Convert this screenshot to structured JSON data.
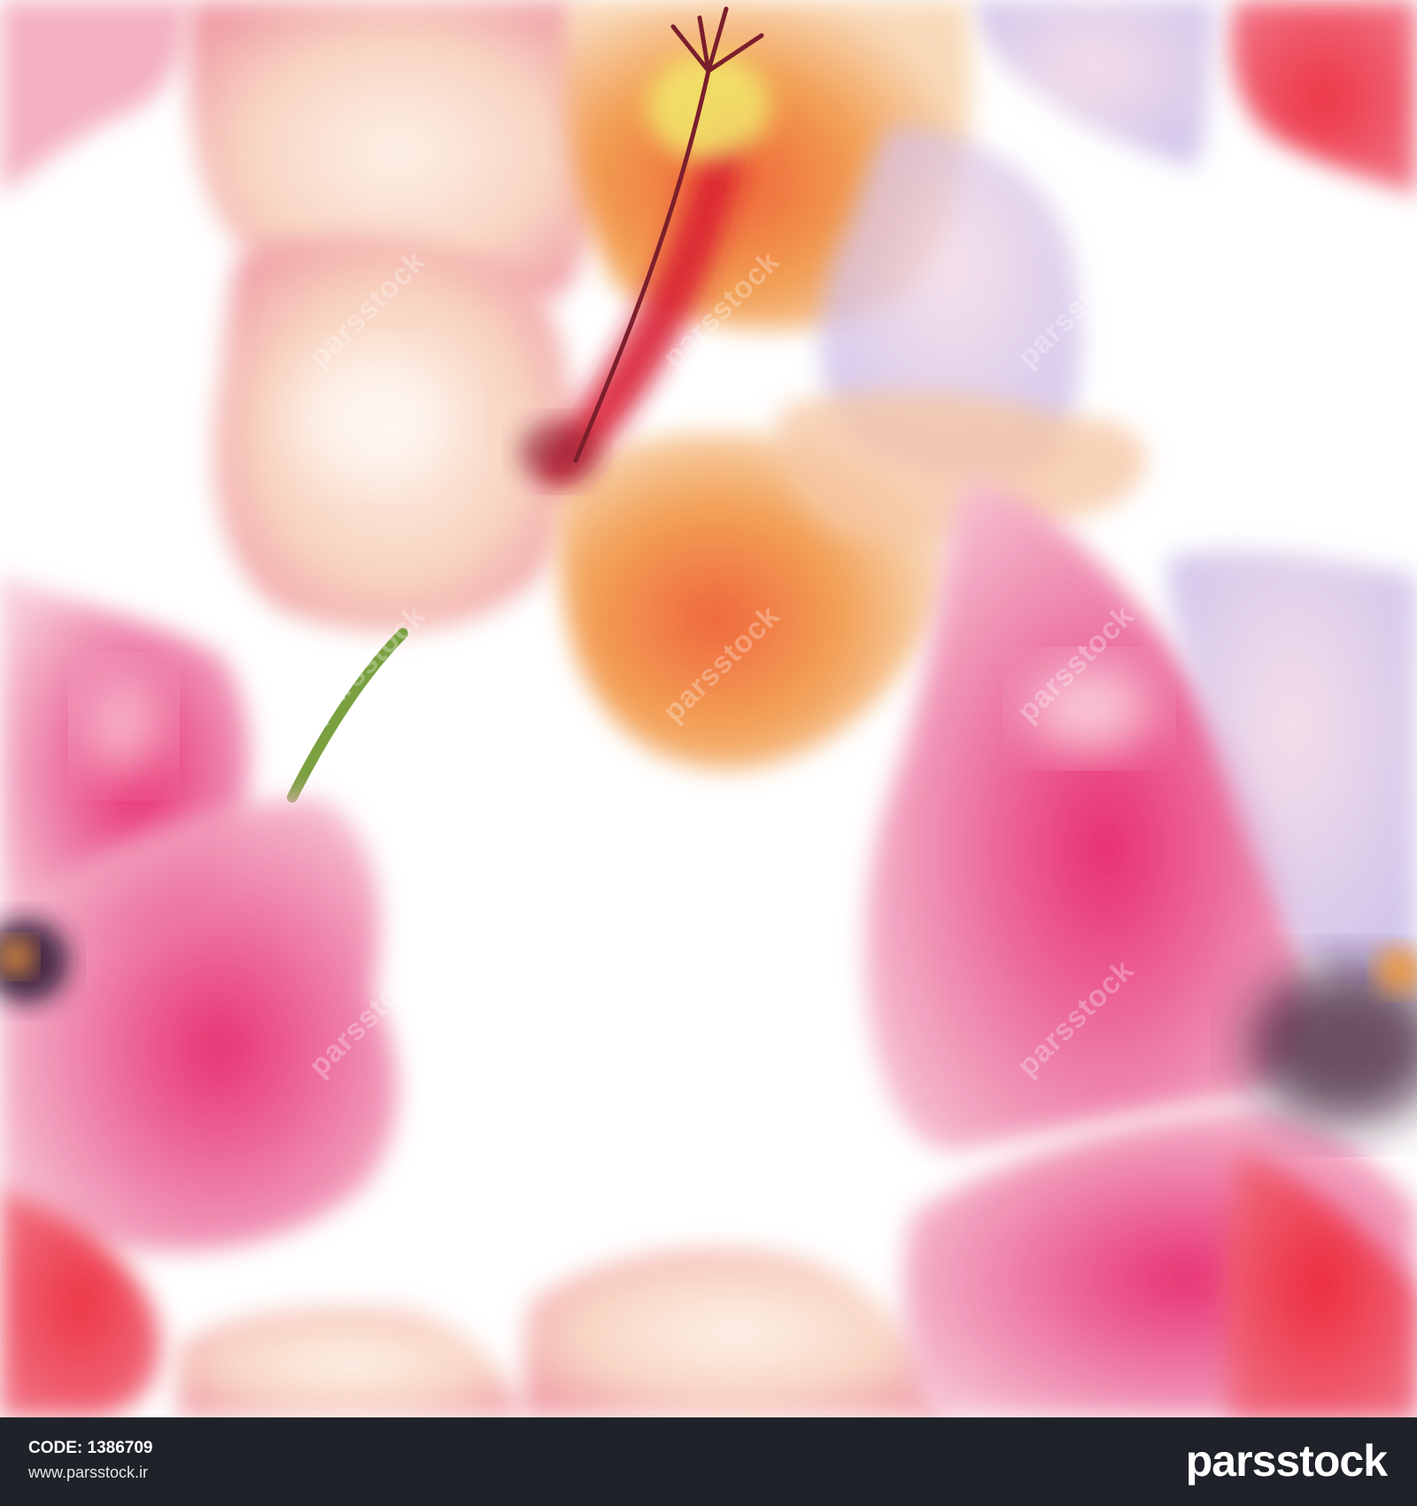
{
  "footer": {
    "code_label": "CODE:",
    "code_value": "1386709",
    "website": "www.parsstock.ir",
    "brand": "parsstock"
  },
  "artwork": {
    "subject": "watercolor-hibiscus-seamless-pattern",
    "colors": {
      "background": "#ffffff",
      "pink": "#e8578c",
      "red": "#e8283a",
      "peach": "#f7c9b0",
      "orange": "#f0843a",
      "yellow": "#f2e46a",
      "stem": "#7aa040",
      "footer_bg": "#1f2228"
    }
  }
}
